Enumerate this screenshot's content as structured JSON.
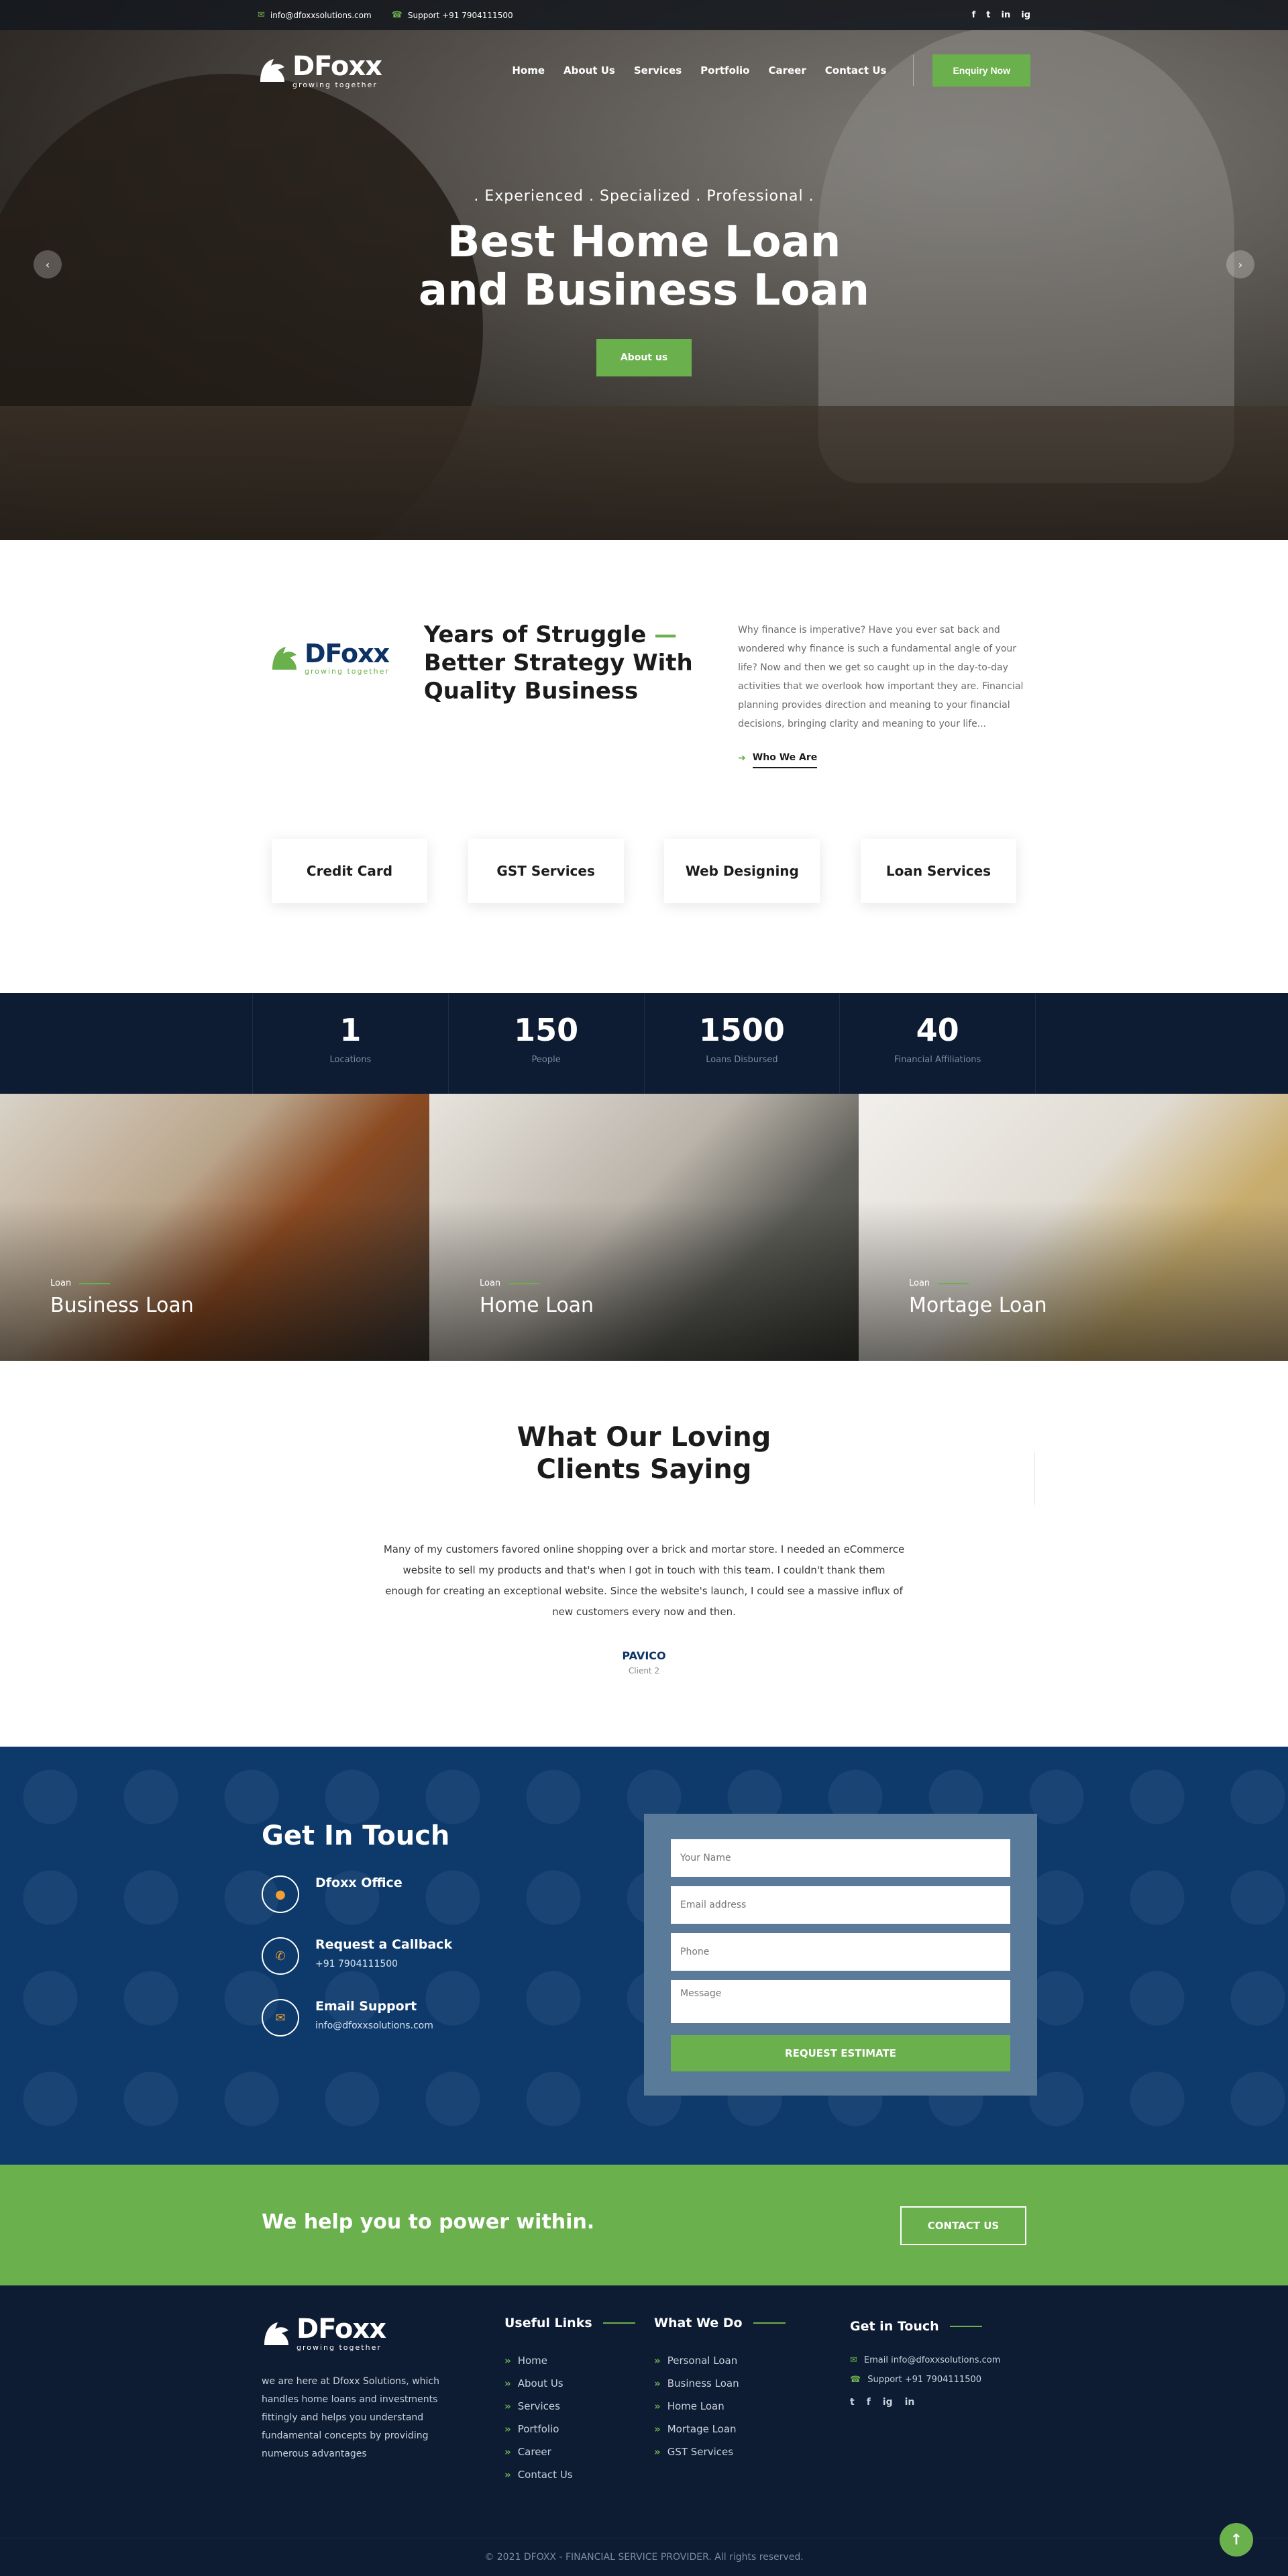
{
  "topbar": {
    "email": "info@dfoxxsolutions.com",
    "support": "Support +91 7904111500",
    "social": [
      "f",
      "t",
      "in",
      "ig"
    ]
  },
  "brand": {
    "name": "DFoxx",
    "tagline": "growing together"
  },
  "nav": {
    "items": [
      "Home",
      "About Us",
      "Services",
      "Portfolio",
      "Career",
      "Contact Us"
    ],
    "cta": "Enquiry Now"
  },
  "hero": {
    "subtitle": ". Experienced .  Specialized .  Professional .",
    "title_line1": "Best Home Loan",
    "title_line2": "and Business Loan",
    "button": "About us",
    "prev_icon": "‹",
    "next_icon": "›"
  },
  "about": {
    "title_line1": "Years of Struggle",
    "title_dash": "—",
    "title_line2": "Better Strategy With",
    "title_line3": "Quality Business",
    "text": "Why finance is imperative? Have you ever sat back and wondered why finance is such a fundamental angle of your life? Now and then we get so caught up in the day-to-day activities that we overlook how important they are. Financial planning provides direction and meaning to your financial decisions, bringing clarity and meaning to your life...",
    "link": "Who We Are"
  },
  "services": [
    "Credit Card",
    "GST Services",
    "Web Designing",
    "Loan Services"
  ],
  "stats": [
    {
      "num": "1",
      "label": "Locations"
    },
    {
      "num": "150",
      "label": "People"
    },
    {
      "num": "1500",
      "label": "Loans Disbursed"
    },
    {
      "num": "40",
      "label": "Financial Affiliations"
    }
  ],
  "loans": [
    {
      "kicker": "Loan",
      "title": "Business Loan"
    },
    {
      "kicker": "Loan",
      "title": "Home Loan"
    },
    {
      "kicker": "Loan",
      "title": "Mortage Loan"
    }
  ],
  "testimonials": {
    "title_line1": "What Our Loving",
    "title_line2": "Clients Saying",
    "quote": "Many of my customers favored online shopping over a brick and mortar store. I needed an eCommerce website to sell my products and that's when I got in touch with this team. I couldn't thank them enough for creating an exceptional website. Since the website's launch, I could see a massive influx of new customers every now and then.",
    "name": "PAVICO",
    "role": "Client 2"
  },
  "contact": {
    "title": "Get In Touch",
    "office": "Dfoxx Office",
    "callback": "Request a Callback",
    "phone": "+91 7904111500",
    "email_title": "Email Support",
    "email": "info@dfoxxsolutions.com",
    "form": {
      "name_ph": "Your Name",
      "email_ph": "Email address",
      "phone_ph": "Phone",
      "message_ph": "Message",
      "submit": "REQUEST ESTIMATE"
    }
  },
  "cta": {
    "text": "We help you to power within.",
    "button": "CONTACT US"
  },
  "footer": {
    "about": "we are here at Dfoxx Solutions, which handles home loans and investments fittingly and helps you understand fundamental concepts by providing numerous advantages",
    "useful_title": "Useful Links",
    "useful": [
      "Home",
      "About Us",
      "Services",
      "Portfolio",
      "Career",
      "Contact Us"
    ],
    "whatwedo_title": "What We Do",
    "whatwedo": [
      "Personal Loan",
      "Business Loan",
      "Home Loan",
      "Mortage Loan",
      "GST Services"
    ],
    "touch_title": "Get in Touch",
    "email_line": "Email info@dfoxxsolutions.com",
    "support_line": "Support +91 7904111500",
    "social": [
      "t",
      "f",
      "ig",
      "in"
    ],
    "copyright": "© 2021 DFOXX - FINANCIAL SERVICE PROVIDER. All rights reserved.",
    "totop": "↑"
  },
  "colors": {
    "accent": "#6ab04c",
    "navy": "#0d1b33",
    "blue": "#0d3a6b"
  }
}
